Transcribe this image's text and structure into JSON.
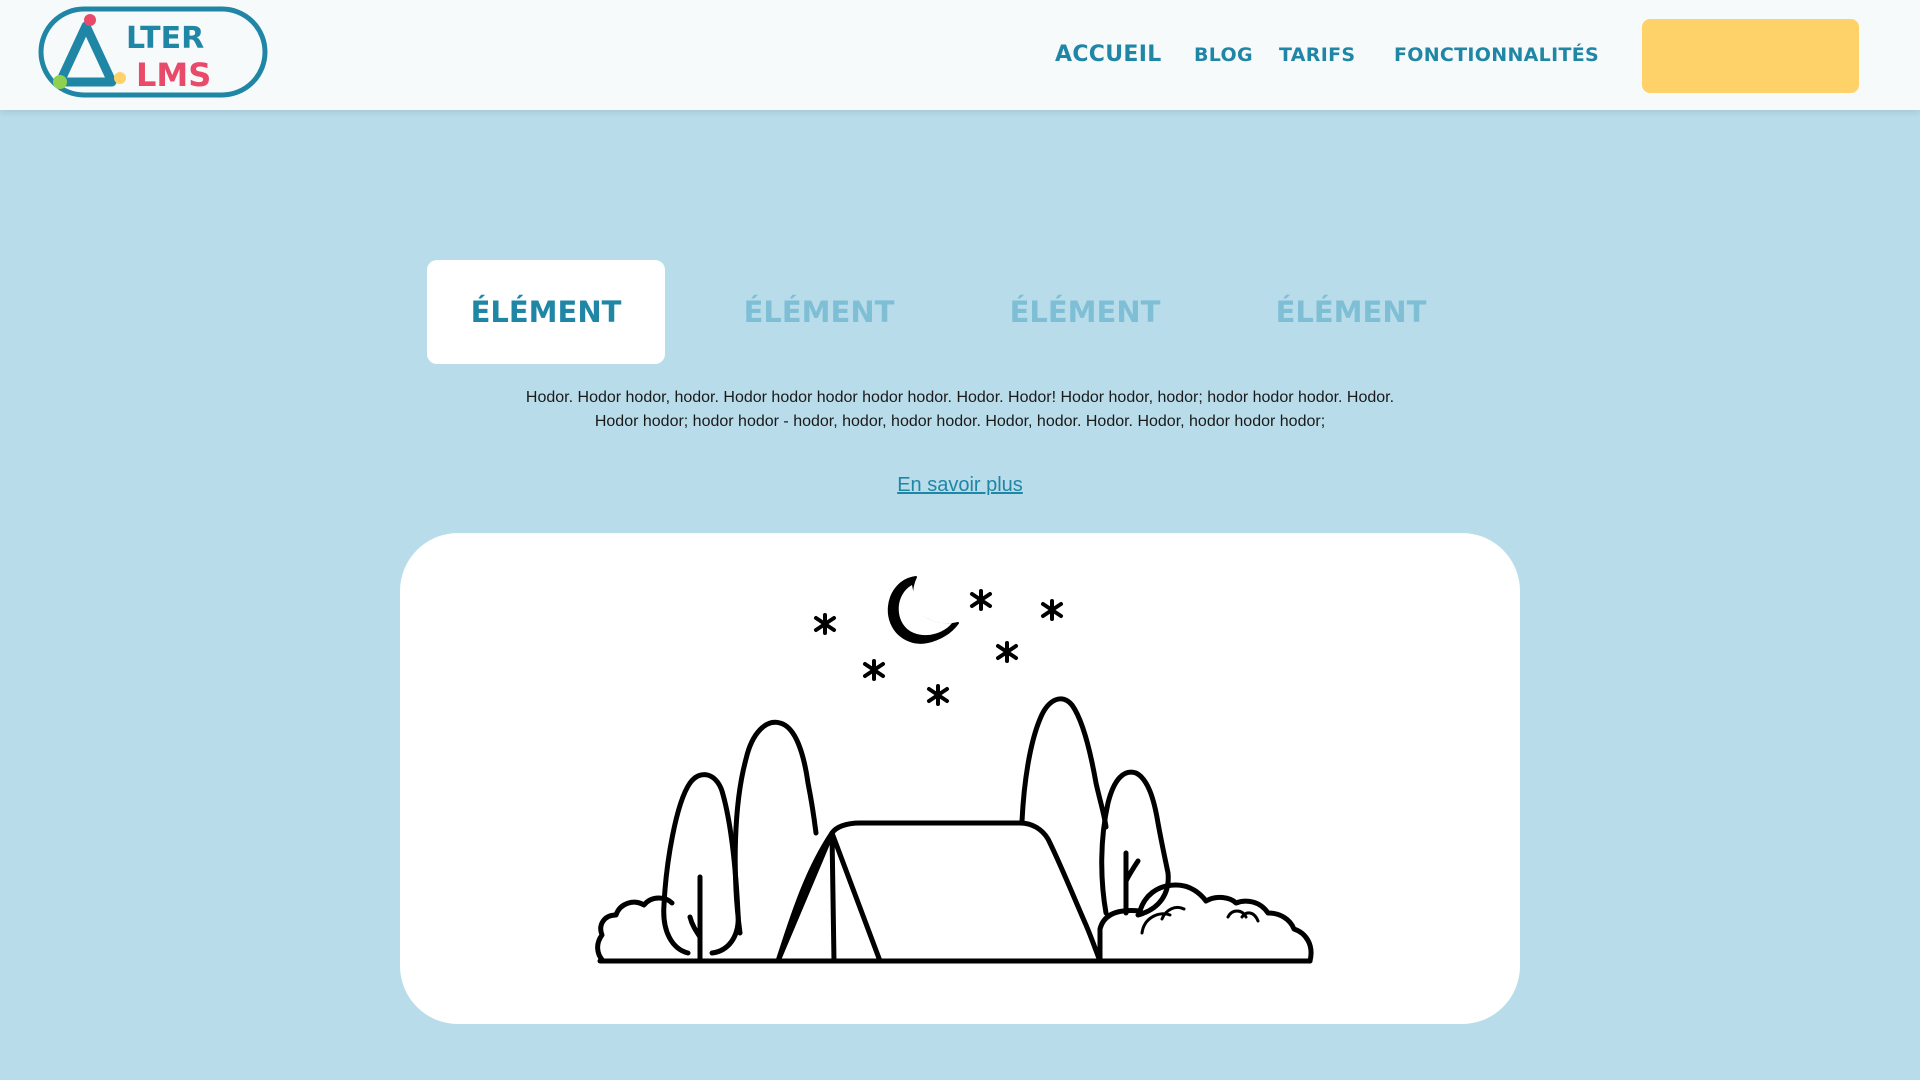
{
  "header": {
    "logo": {
      "line1": "LTER",
      "line2": "LMS",
      "brand_colors": [
        "#1f86a6",
        "#e94a6a",
        "#8fd14f",
        "#ffd169"
      ]
    },
    "nav": {
      "accueil": "ACCUEIL",
      "blog": "BLOG",
      "tarifs": "TARIFS",
      "fonctionnalites": "FONCTIONNALITÉS"
    },
    "cta_label": ""
  },
  "tabs": [
    {
      "label": "ÉLÉMENT",
      "active": true
    },
    {
      "label": "ÉLÉMENT",
      "active": false
    },
    {
      "label": "ÉLÉMENT",
      "active": false
    },
    {
      "label": "ÉLÉMENT",
      "active": false
    }
  ],
  "content": {
    "text_line1": "Hodor. Hodor hodor, hodor. Hodor hodor hodor hodor hodor. Hodor. Hodor! Hodor hodor, hodor; hodor hodor hodor. Hodor.",
    "text_line2": "Hodor hodor; hodor hodor - hodor, hodor, hodor hodor. Hodor, hodor. Hodor. Hodor, hodor hodor hodor;",
    "link": "En savoir plus"
  },
  "illustration": {
    "icon": "camping-tent-night-illustration"
  },
  "colors": {
    "accent": "#1f86a6",
    "tab_inactive": "#7fbfd6",
    "background": "#b8dcea",
    "cta": "#ffd169"
  }
}
